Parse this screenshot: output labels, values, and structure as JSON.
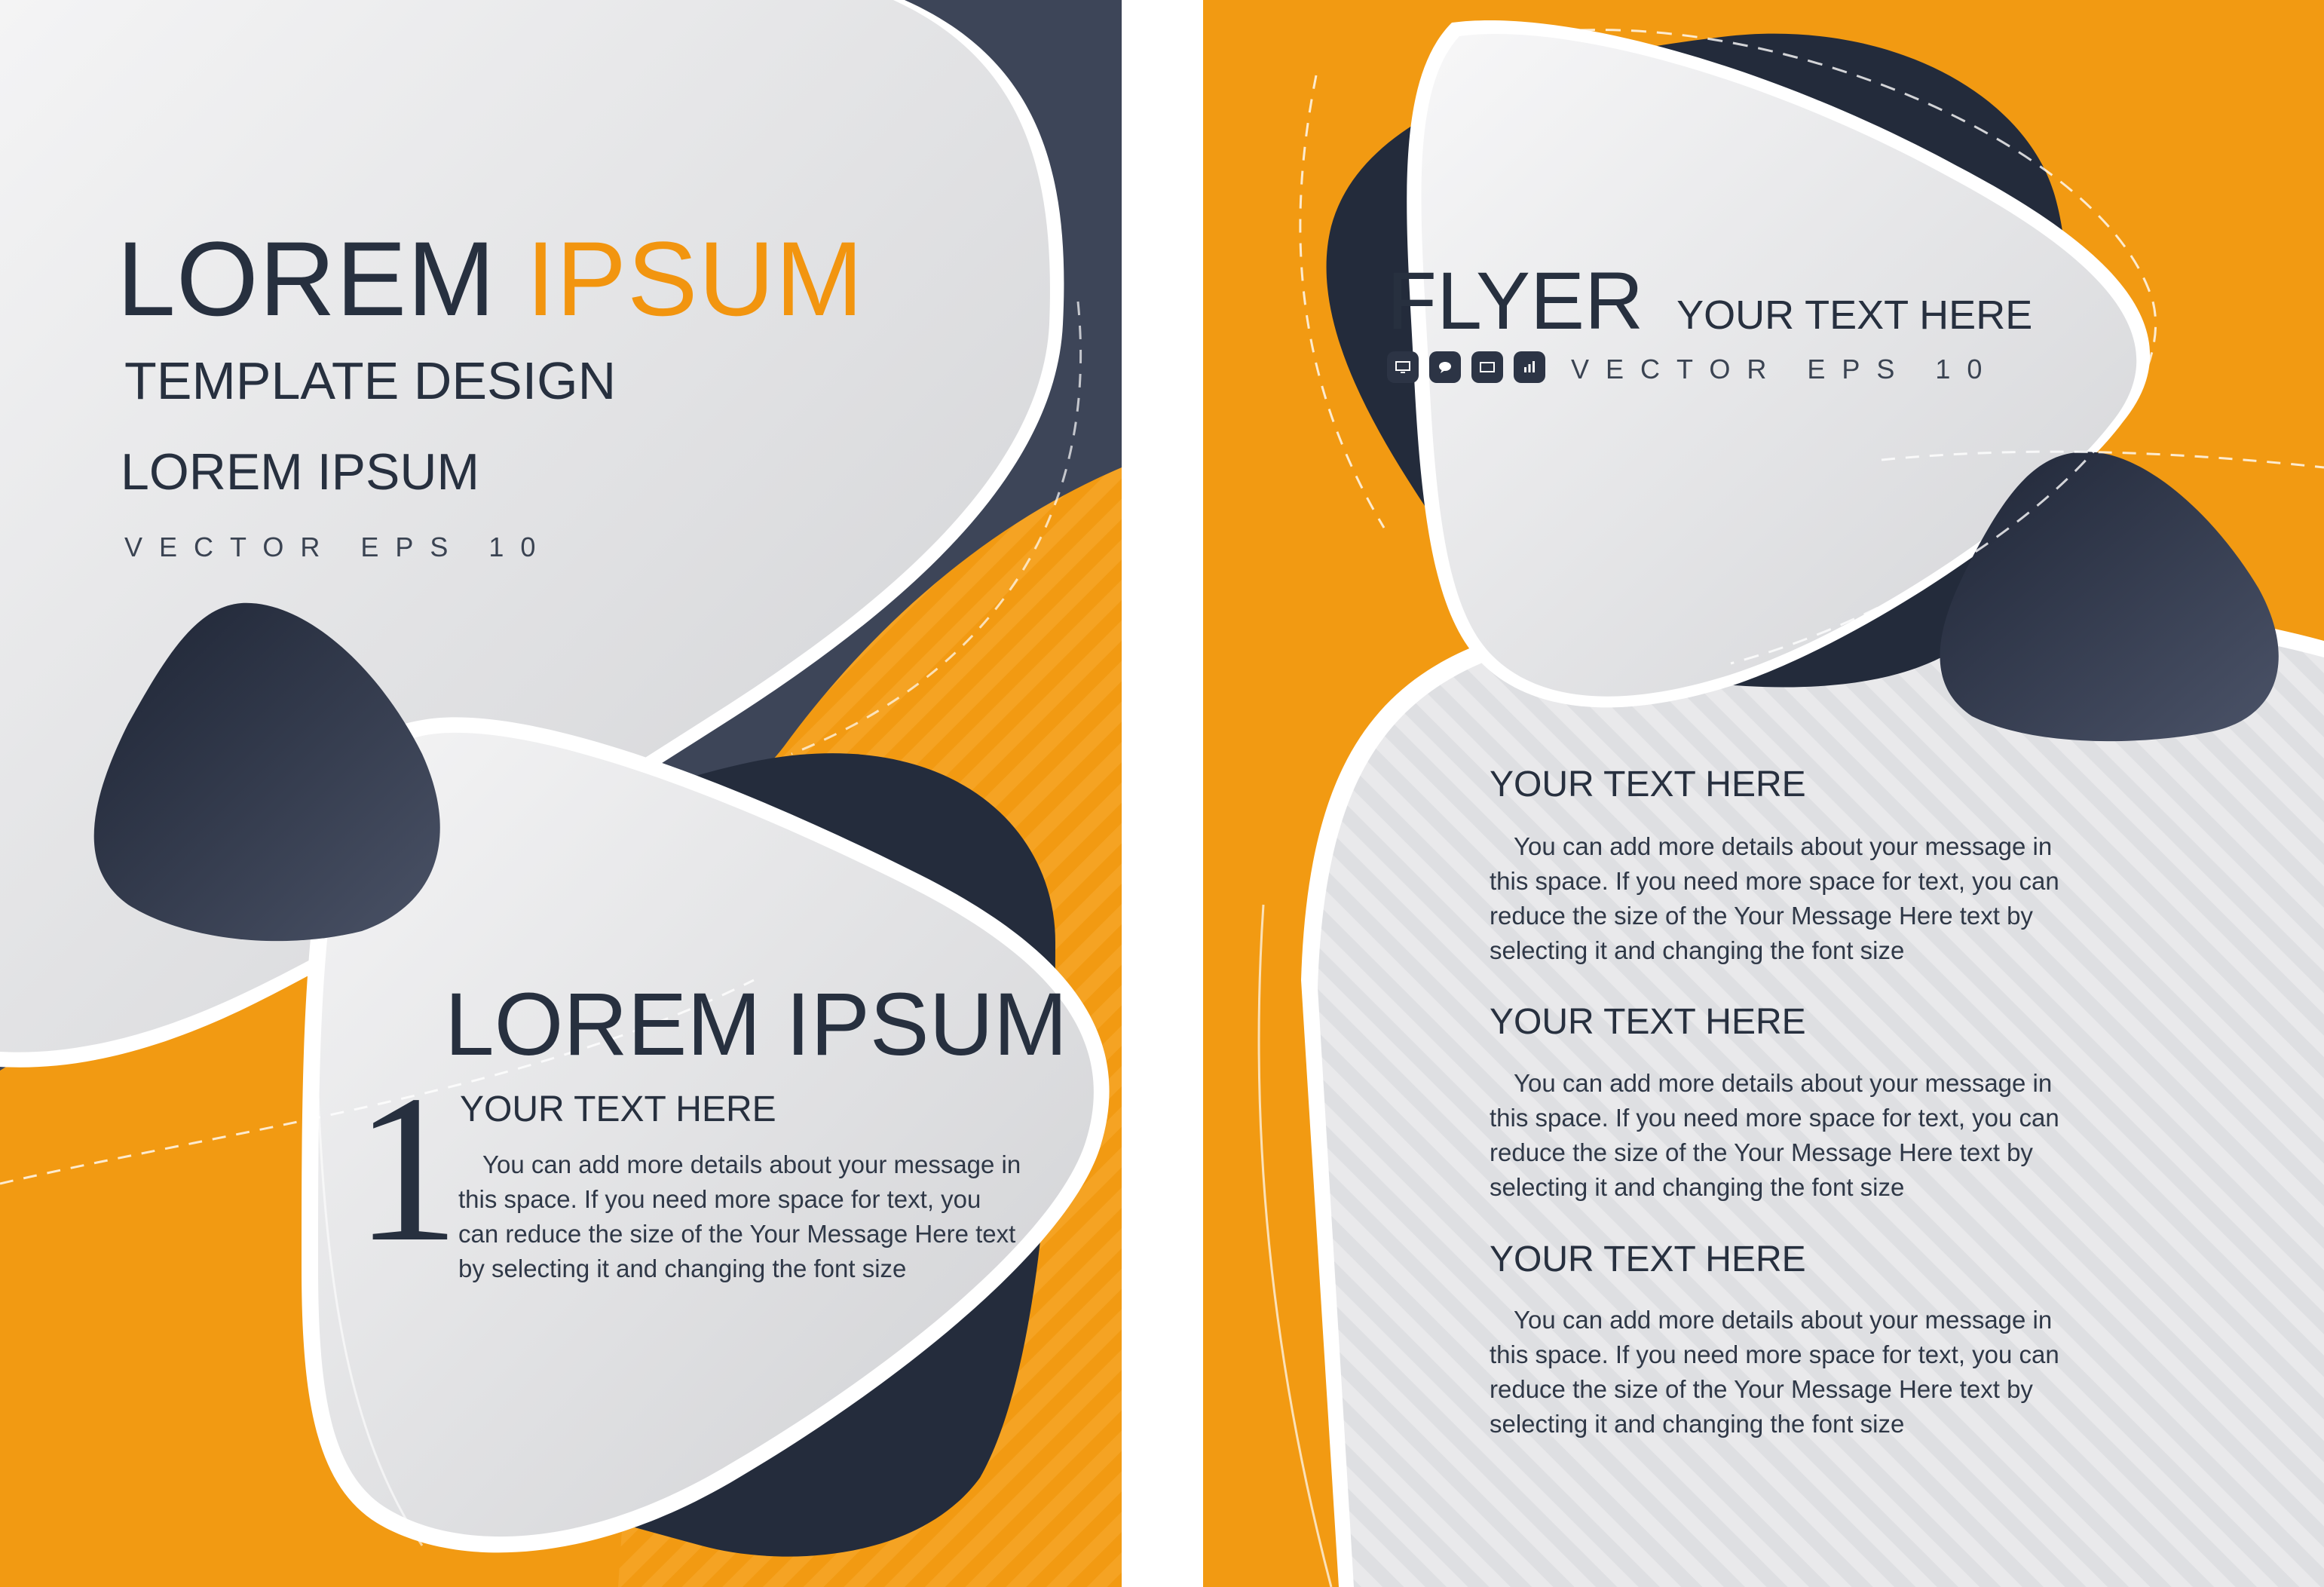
{
  "colors": {
    "accent_orange": "#f29a12",
    "dark_navy": "#2a3244",
    "light_gray": "#e6e7e9",
    "text_dark": "#27303f"
  },
  "left_flyer": {
    "title_word1": "LOREM",
    "title_word2": "IPSUM",
    "subtitle": "TEMPLATE DESIGN",
    "subtitle2": "LOREM IPSUM",
    "vector_label": "VECTOR EPS 10",
    "section_number": "1",
    "section_title": "LOREM IPSUM",
    "section_heading": "YOUR TEXT HERE",
    "section_body": "You can add more details about your message in this space. If you need more space for text, you can reduce the size of the Your Message Here text by selecting it and changing the font size"
  },
  "right_flyer": {
    "title": "FLYER",
    "title_tagline": "YOUR TEXT HERE",
    "vector_label": "VECTOR EPS 10",
    "icons": [
      "monitor-icon",
      "chat-bubble-icon",
      "screen-icon",
      "bar-chart-icon"
    ],
    "blocks": [
      {
        "heading": "YOUR TEXT HERE",
        "body": "You can add more details about your message in this space. If you need more space for text, you can reduce the size of the Your Message Here text by selecting it and changing the font size"
      },
      {
        "heading": "YOUR TEXT HERE",
        "body": "You can add more details about your message in this space. If you need more space for text, you can reduce the size of the Your Message Here text by selecting it and changing the font size"
      },
      {
        "heading": "YOUR TEXT HERE",
        "body": "You can add more details about your message in this space. If you need more space for text, you can reduce the size of the Your Message Here text by selecting it and changing the font size"
      }
    ]
  }
}
